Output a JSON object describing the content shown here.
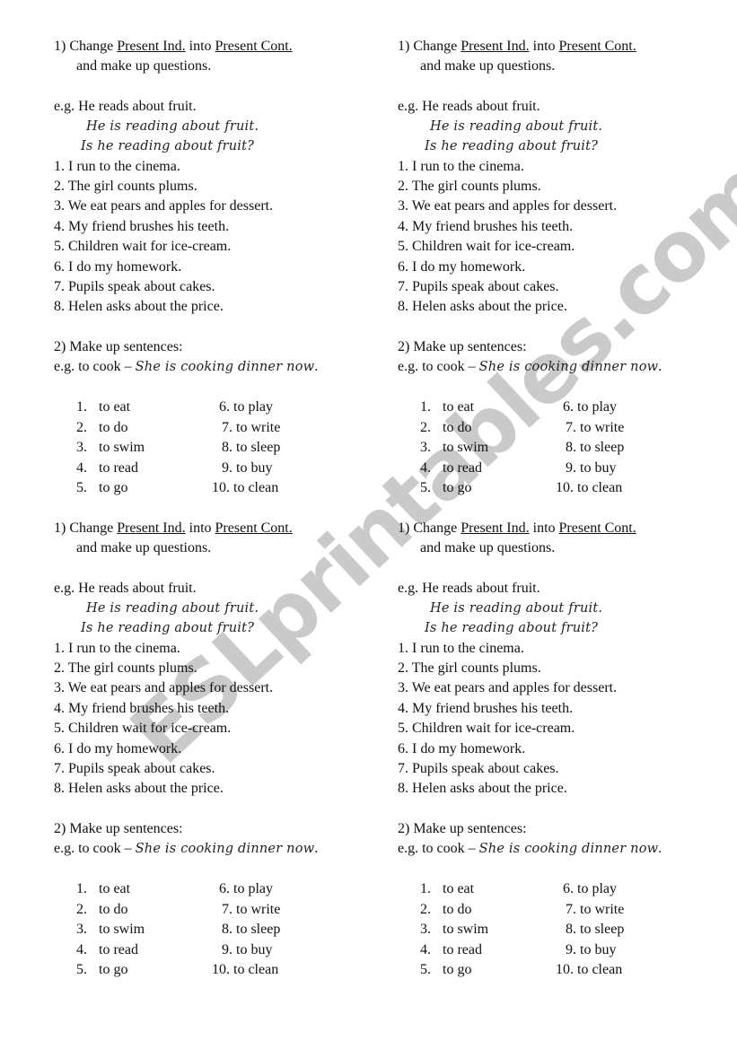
{
  "watermark": "ESLprintables.com",
  "worksheet": {
    "task1": {
      "number": "1)",
      "word_change": "Change",
      "from_tense": "Present Ind.",
      "word_into": "into",
      "to_tense": "Present Cont.",
      "line2": "and make up questions.",
      "example_label": "e.g.",
      "example_sentence": "He reads about fruit.",
      "example_continuous": "He is reading about fruit.",
      "example_question": "Is he reading about fruit?",
      "sentences": [
        "1. I run to the cinema.",
        "2. The girl counts plums.",
        "3. We eat pears and apples for dessert.",
        "4. My friend brushes his teeth.",
        "5. Children wait for ice-cream.",
        "6. I do my homework.",
        "7. Pupils speak about cakes.",
        "8. Helen asks about the price."
      ]
    },
    "task2": {
      "title": "2) Make up sentences:",
      "example_prefix": "e.g. to cook – ",
      "example_sentence": "She is cooking dinner now",
      "example_end": ".",
      "verbs_left": [
        {
          "num": "1.",
          "verb": "to eat"
        },
        {
          "num": "2.",
          "verb": "to do"
        },
        {
          "num": "3.",
          "verb": "to swim"
        },
        {
          "num": "4.",
          "verb": "to read"
        },
        {
          "num": "5.",
          "verb": "to go"
        }
      ],
      "verbs_right": [
        {
          "num": "6.",
          "verb": "to play"
        },
        {
          "num": "7.",
          "verb": "to write"
        },
        {
          "num": "8.",
          "verb": "to sleep"
        },
        {
          "num": "9.",
          "verb": "to buy"
        },
        {
          "num": "10.",
          "verb": "to clean"
        }
      ]
    }
  }
}
